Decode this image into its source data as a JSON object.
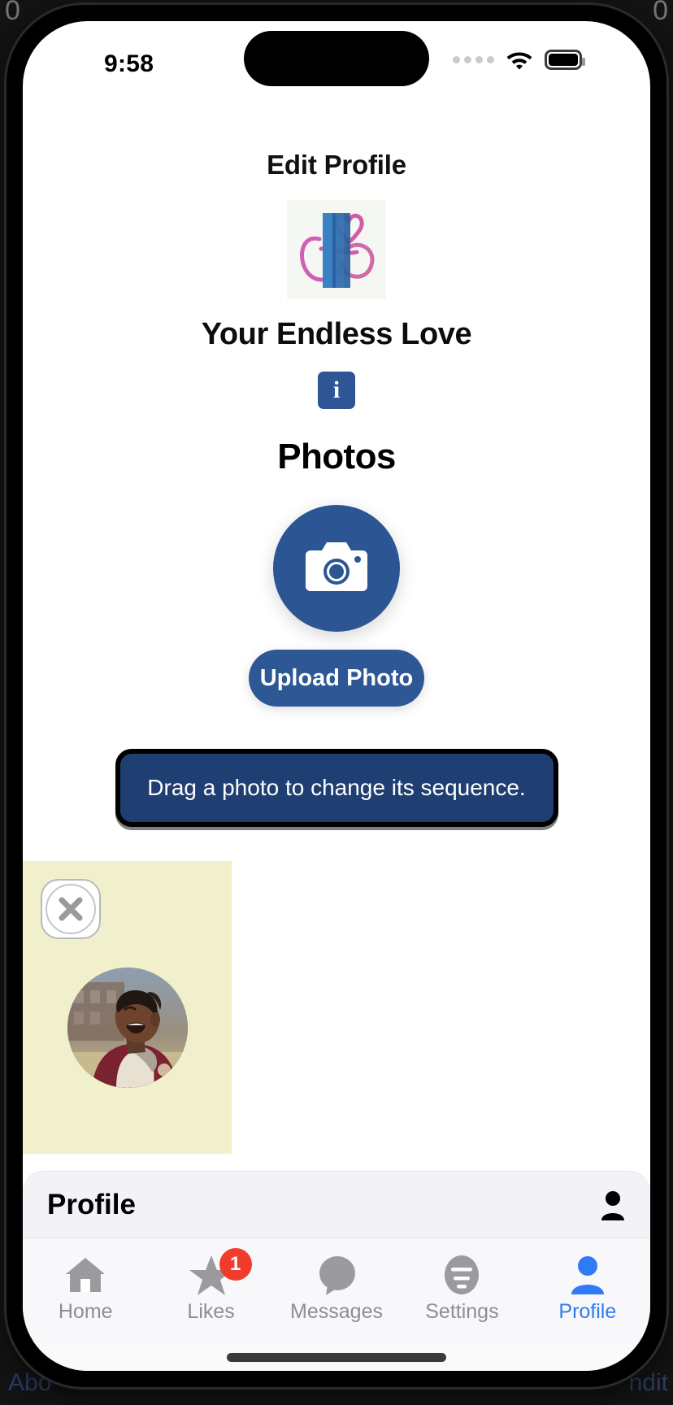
{
  "status_bar": {
    "time": "9:58",
    "signal_dots": 4,
    "wifi_icon": "wifi-icon",
    "battery_icon": "battery-full-icon"
  },
  "page": {
    "title": "Edit Profile",
    "brand_name": "Your Endless Love",
    "logo_icon": "endless-love-logo",
    "info_badge_label": "i",
    "photos_heading": "Photos"
  },
  "actions": {
    "camera_icon": "camera-icon",
    "upload_label": "Upload Photo",
    "drag_hint": "Drag a photo to change its sequence."
  },
  "photos": [
    {
      "remove_icon": "close-circle-icon",
      "thumb_alt": "portrait-laughing-man"
    }
  ],
  "profile_bar": {
    "title": "Profile",
    "icon": "person-icon"
  },
  "tabs": [
    {
      "label": "Home",
      "icon": "home-icon",
      "active": false,
      "badge": ""
    },
    {
      "label": "Likes",
      "icon": "star-icon",
      "active": false,
      "badge": "1"
    },
    {
      "label": "Messages",
      "icon": "chat-icon",
      "active": false,
      "badge": ""
    },
    {
      "label": "Settings",
      "icon": "sliders-icon",
      "active": false,
      "badge": ""
    },
    {
      "label": "Profile",
      "icon": "person-icon",
      "active": true,
      "badge": ""
    }
  ],
  "background": {
    "left_text": "Abo",
    "right_text": "ndit",
    "corner_left": "0",
    "corner_right": "0"
  },
  "colors": {
    "brand_blue": "#2b5693",
    "hint_navy": "#1f3f72",
    "card_yellow": "#f0f0cd",
    "badge_red": "#f03b2d",
    "active_tab_blue": "#2f7bf6"
  }
}
